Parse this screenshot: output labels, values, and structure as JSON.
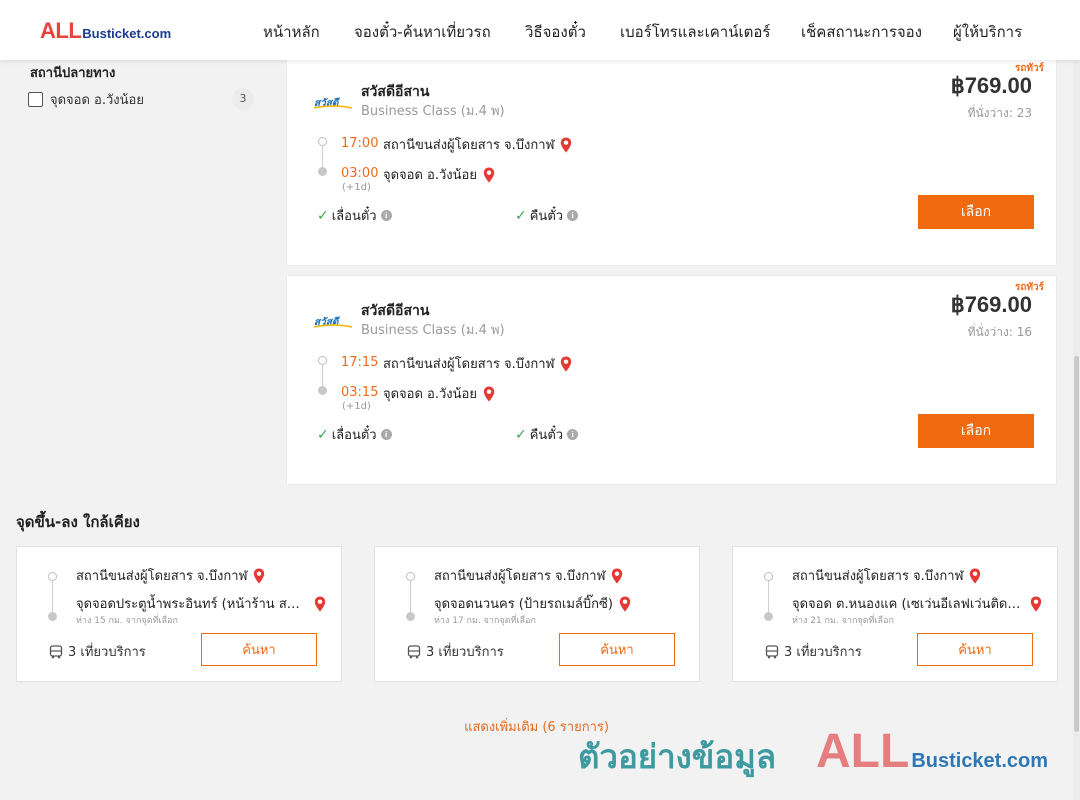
{
  "header": {
    "logo_all": "ALL",
    "logo_rest": "Busticket.com",
    "nav": [
      "หน้าหลัก",
      "จองตั๋ว-ค้นหาเที่ยวรถ",
      "วิธีจองตั๋ว",
      "เบอร์โทรและเคาน์เตอร์",
      "เช็คสถานะการจอง",
      "ผู้ให้บริการ"
    ]
  },
  "sidebar": {
    "filter_title": "สถานีปลายทาง",
    "filter_option": {
      "label": "จุดจอด อ.วังน้อย",
      "count": "3"
    }
  },
  "trips": [
    {
      "tag": "รถทัวร์",
      "operator": "สวัสดีอีสาน",
      "bus_class": "Business Class (ม.4 พ)",
      "price": "฿769.00",
      "seats": "ที่นั่งว่าง: 23",
      "depart_time": "17:00",
      "depart_stop": "สถานีขนส่งผู้โดยสาร จ.บึงกาฬ",
      "arrive_time": "03:00",
      "arrive_stop": "จุดจอด อ.วังน้อย",
      "plus_day": "(+1d)",
      "feature1": "เลื่อนตั๋ว",
      "feature2": "คืนตั๋ว",
      "button": "เลือก"
    },
    {
      "tag": "รถทัวร์",
      "operator": "สวัสดีอีสาน",
      "bus_class": "Business Class (ม.4 พ)",
      "price": "฿769.00",
      "seats": "ที่นั่งว่าง: 16",
      "depart_time": "17:15",
      "depart_stop": "สถานีขนส่งผู้โดยสาร จ.บึงกาฬ",
      "arrive_time": "03:15",
      "arrive_stop": "จุดจอด อ.วังน้อย",
      "plus_day": "(+1d)",
      "feature1": "เลื่อนตั๋ว",
      "feature2": "คืนตั๋ว",
      "button": "เลือก"
    }
  ],
  "nearby": {
    "title": "จุดขึ้น-ลง ใกล้เคียง",
    "cards": [
      {
        "from": "สถานีขนส่งผู้โดยสาร จ.บึงกาฬ",
        "to": "จุดจอดประตูน้ำพระอินทร์ (หน้าร้าน สหกรณ์)",
        "distance": "ห่าง 15 กม. จากจุดที่เลือก",
        "trips": "3 เที่ยวบริการ",
        "button": "ค้นหา"
      },
      {
        "from": "สถานีขนส่งผู้โดยสาร จ.บึงกาฬ",
        "to": "จุดจอดนวนคร (ป้ายรถเมล์บิ๊กซี)",
        "distance": "ห่าง 17 กม. จากจุดที่เลือก",
        "trips": "3 เที่ยวบริการ",
        "button": "ค้นหา"
      },
      {
        "from": "สถานีขนส่งผู้โดยสาร จ.บึงกาฬ",
        "to": "จุดจอด ต.หนองแค (เซเว่นอีเลฟเว่นติดถนน)",
        "distance": "ห่าง 21 กม. จากจุดที่เลือก",
        "trips": "3 เที่ยวบริการ",
        "button": "ค้นหา"
      }
    ],
    "show_more": "แสดงเพิ่มเติม (6 รายการ)"
  },
  "watermark": {
    "thai": "ตัวอย่างข้อมูล",
    "logo_all": "ALL",
    "logo_rest": "Busticket.com"
  },
  "colors": {
    "accent": "#f26a10",
    "brand_red": "#e8433a",
    "brand_blue": "#1c3b8c"
  }
}
